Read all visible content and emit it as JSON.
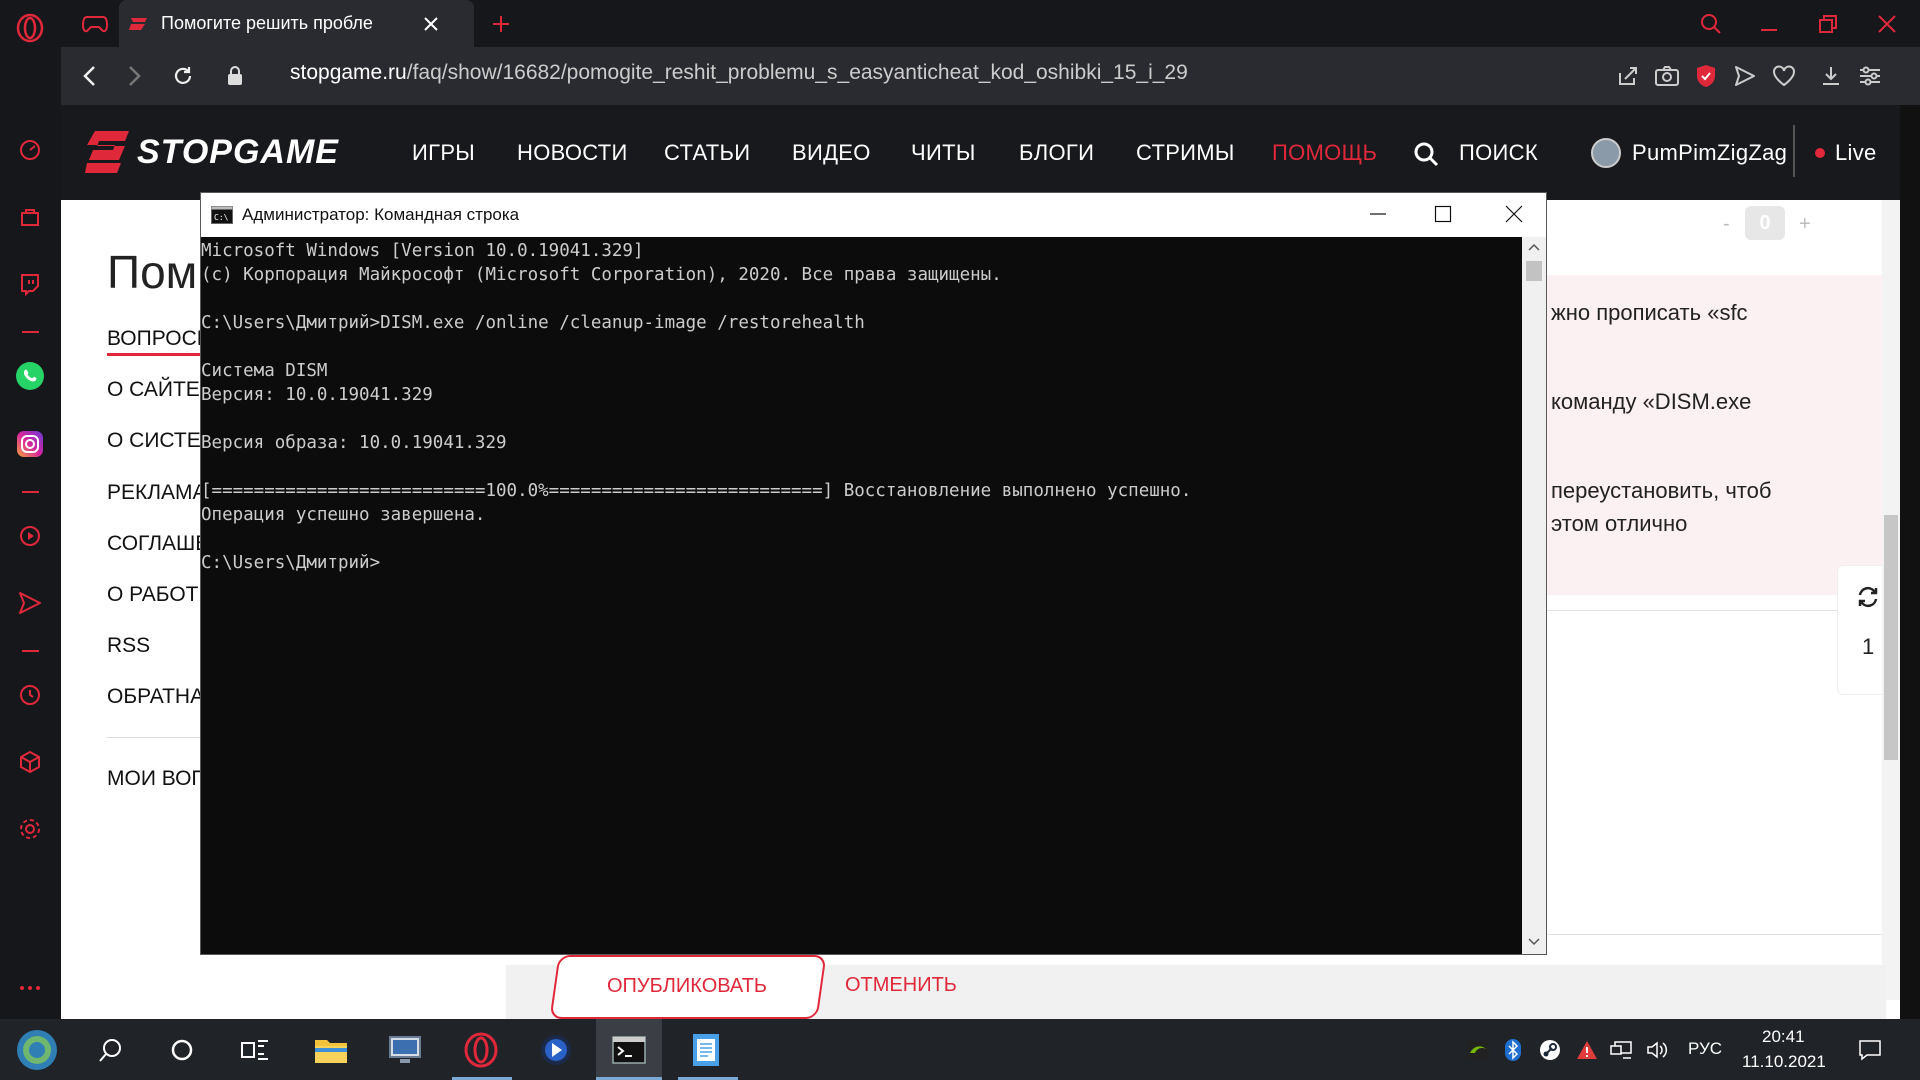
{
  "browser": {
    "tab_title": "Помогите решить пробле",
    "url_host": "stopgame.ru",
    "url_path": "/faq/show/16682/pomogite_reshit_problemu_s_easyanticheat_kod_oshibki_15_i_29"
  },
  "site": {
    "logo": "STOPGAME",
    "nav": [
      "ИГРЫ",
      "НОВОСТИ",
      "СТАТЬИ",
      "ВИДЕО",
      "ЧИТЫ",
      "БЛОГИ",
      "СТРИМЫ",
      "ПОМОЩЬ"
    ],
    "active_nav": "ПОМОЩЬ",
    "search_label": "ПОИСК",
    "username": "PumPimZigZag",
    "live_label": "Live",
    "page_title": "Пом",
    "left_menu": [
      "ВОПРОСЫ",
      "О САЙТЕ",
      "О СИСТЕМ",
      "РЕКЛАМА",
      "СОГЛАШЕ",
      "О РАБОТЕ",
      "RSS",
      "ОБРАТНАЯ",
      "МОИ ВОП"
    ],
    "vote_minus": "-",
    "vote_value": "0",
    "vote_plus": "+",
    "answer_lines": [
      "жно прописать «sfc",
      "команду «DISM.exe",
      "переустановить, чтоб",
      "этом отлично"
    ],
    "side_count": "1",
    "publish_button": "ОПУБЛИКОВАТЬ",
    "cancel_button": "ОТМЕНИТЬ"
  },
  "cmd": {
    "title": "Администратор: Командная строка",
    "lines": [
      "Microsoft Windows [Version 10.0.19041.329]",
      "(c) Корпорация Майкрософт (Microsoft Corporation), 2020. Все права защищены.",
      "",
      "C:\\Users\\Дмитрий>DISM.exe /online /cleanup-image /restorehealth",
      "",
      "Cистема DISM",
      "Версия: 10.0.19041.329",
      "",
      "Версия образа: 10.0.19041.329",
      "",
      "[==========================100.0%==========================] Восстановление выполнено успешно.",
      "Операция успешно завершена.",
      "",
      "C:\\Users\\Дмитрий>"
    ]
  },
  "taskbar": {
    "lang": "РУС",
    "time": "20:41",
    "date": "11.10.2021"
  },
  "colors": {
    "accent_red": "#e0283b",
    "cmd_bg": "#0c0c0c",
    "cmd_text": "#cccccc"
  }
}
